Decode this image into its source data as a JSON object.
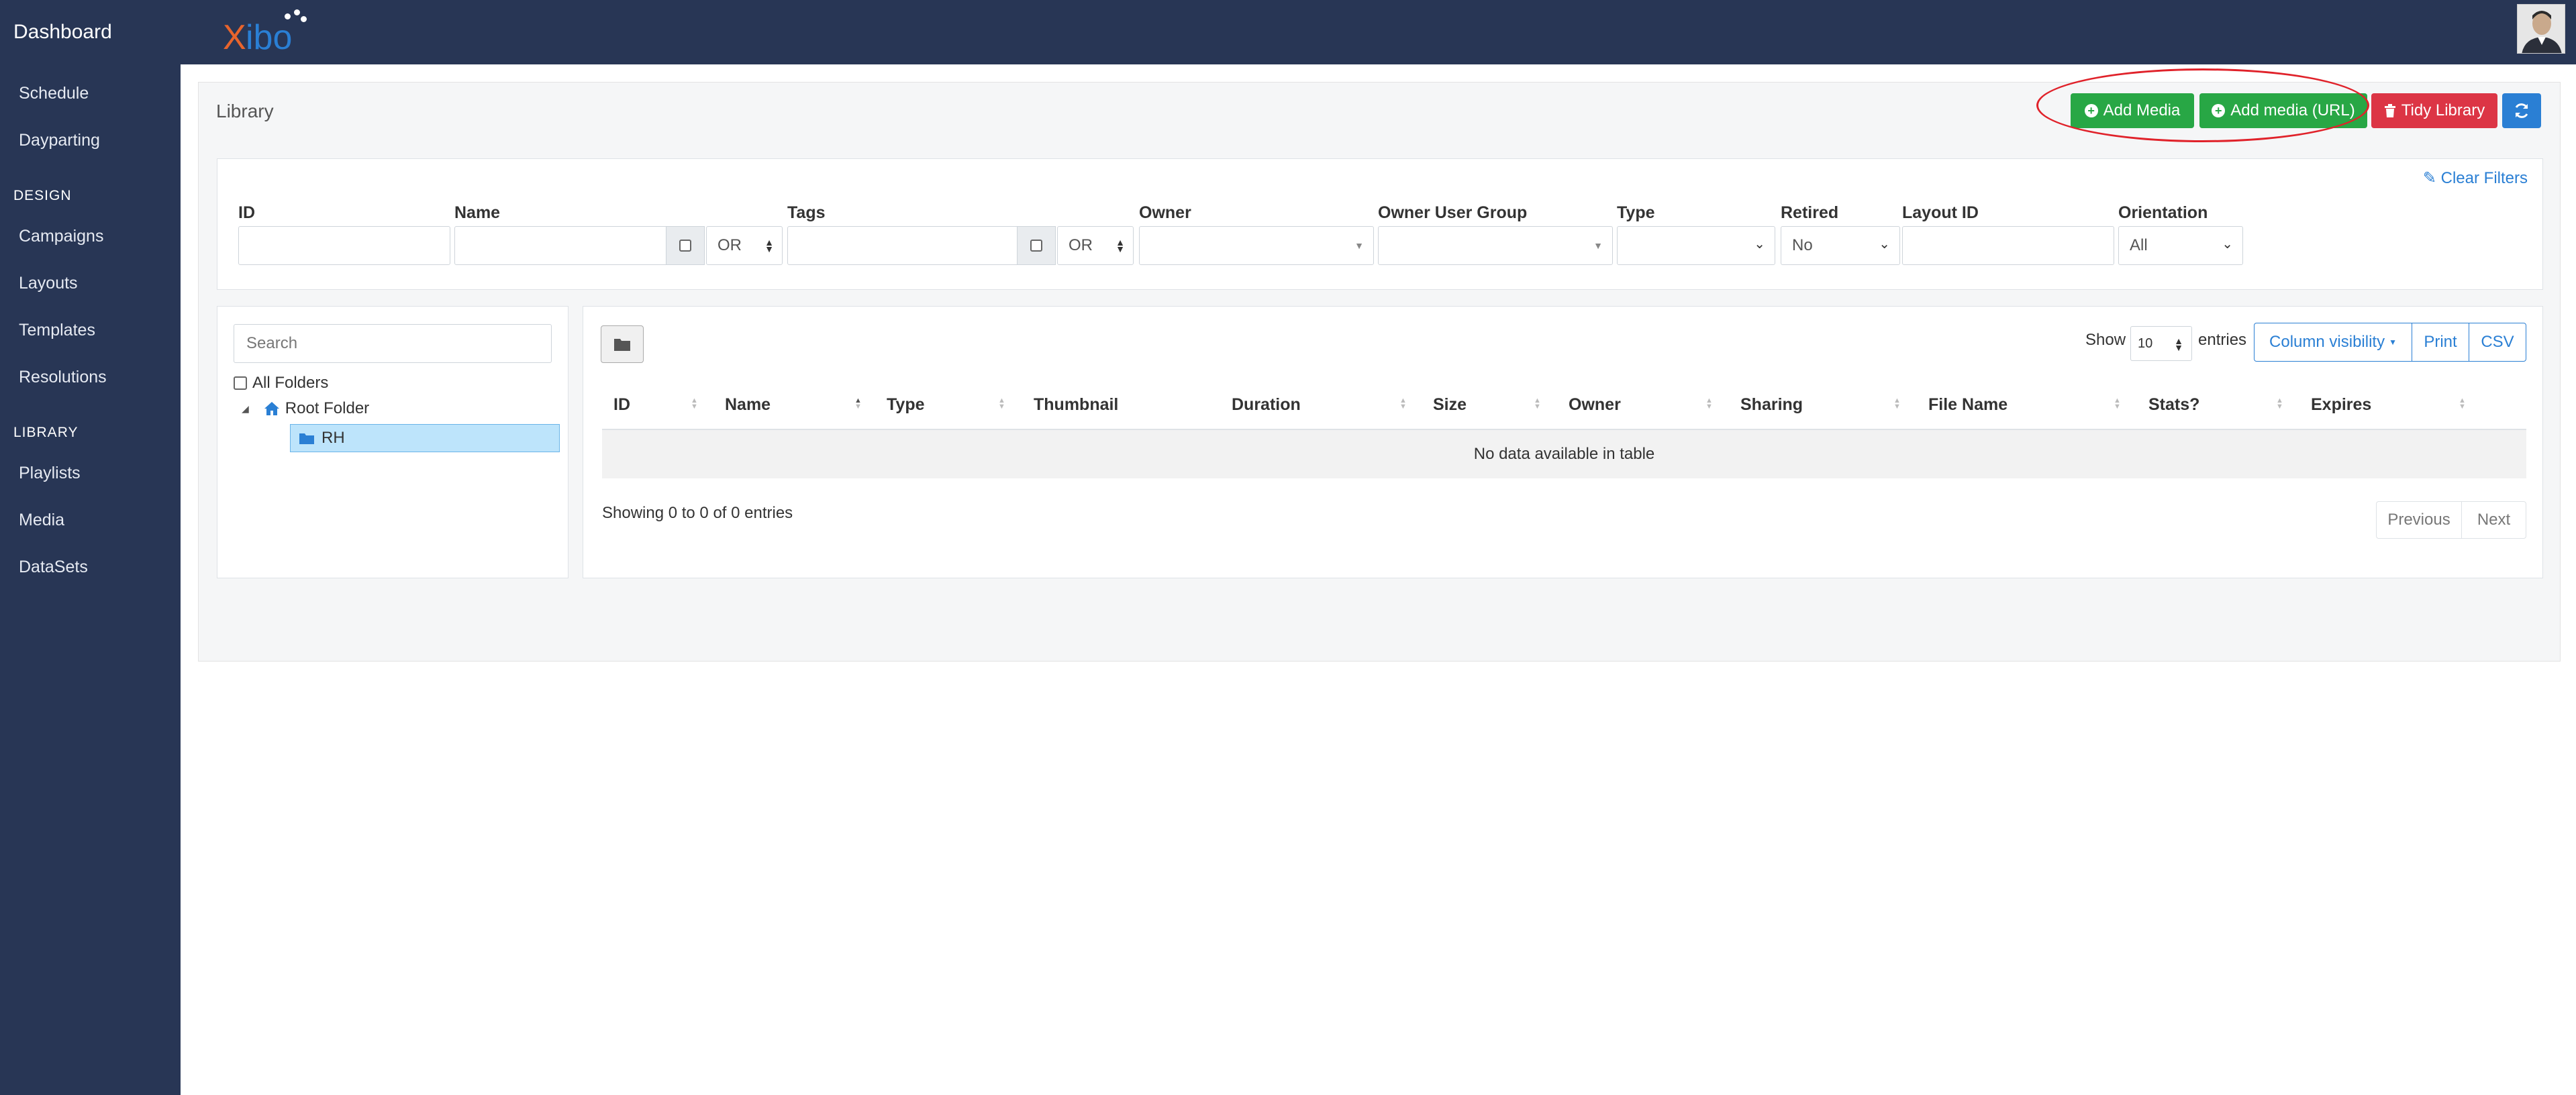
{
  "header": {
    "brand": "Dashboard",
    "logo_x": "X",
    "logo_rest": "ibo",
    "avatar_icon": "user-avatar"
  },
  "sidebar": {
    "items_top": [
      {
        "label": "Schedule"
      },
      {
        "label": "Dayparting"
      }
    ],
    "design_heading": "DESIGN",
    "design_items": [
      {
        "label": "Campaigns"
      },
      {
        "label": "Layouts"
      },
      {
        "label": "Templates"
      },
      {
        "label": "Resolutions"
      }
    ],
    "library_heading": "LIBRARY",
    "library_items": [
      {
        "label": "Playlists"
      },
      {
        "label": "Media"
      },
      {
        "label": "DataSets"
      }
    ]
  },
  "page": {
    "title": "Library",
    "add_media": "Add Media",
    "add_media_url": "Add media (URL)",
    "tidy_library": "Tidy Library",
    "refresh_icon": "refresh-icon"
  },
  "filters": {
    "clear": "Clear Filters",
    "id_label": "ID",
    "name_label": "Name",
    "name_logic": "OR",
    "tags_label": "Tags",
    "tags_logic": "OR",
    "owner_label": "Owner",
    "owner_group_label": "Owner User Group",
    "type_label": "Type",
    "retired_label": "Retired",
    "retired_value": "No",
    "layout_id_label": "Layout ID",
    "orientation_label": "Orientation",
    "orientation_value": "All"
  },
  "folders": {
    "search_placeholder": "Search",
    "all_folders": "All Folders",
    "root": "Root Folder",
    "selected": "RH"
  },
  "table": {
    "show": "Show",
    "entries_value": "10",
    "entries": "entries",
    "column_visibility": "Column visibility",
    "print": "Print",
    "csv": "CSV",
    "columns": [
      "ID",
      "Name",
      "Type",
      "Thumbnail",
      "Duration",
      "Size",
      "Owner",
      "Sharing",
      "File Name",
      "Stats?",
      "Expires"
    ],
    "empty": "No data available in table",
    "info": "Showing 0 to 0 of 0 entries",
    "previous": "Previous",
    "next": "Next"
  },
  "colors": {
    "nav": "#283655",
    "green": "#28a745",
    "red": "#dc3545",
    "blue": "#2a7fd4",
    "annotation": "#e0222a"
  }
}
